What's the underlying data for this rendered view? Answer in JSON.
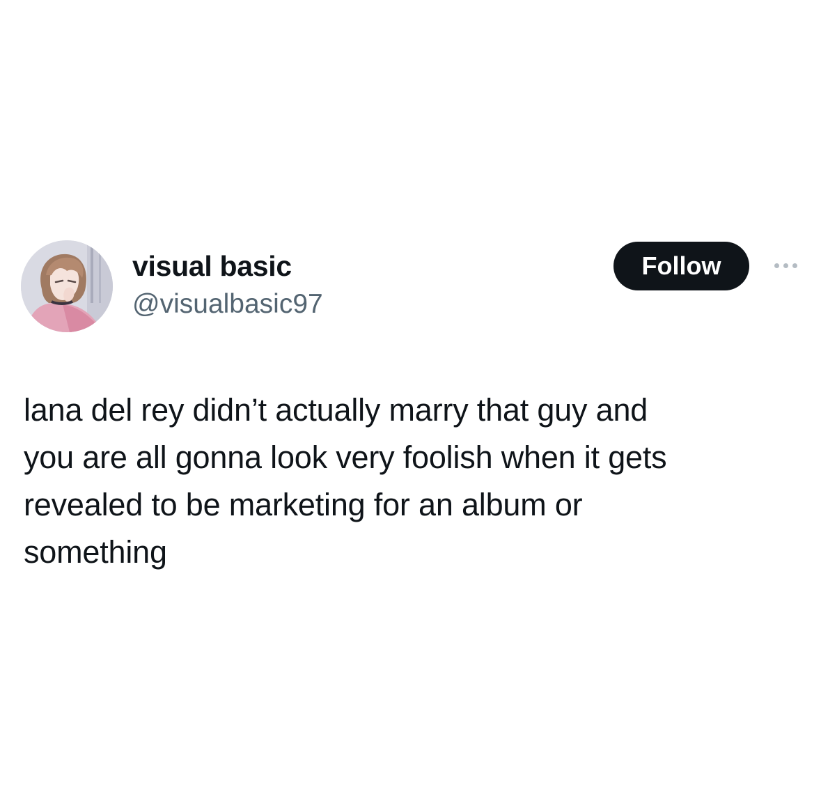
{
  "author": {
    "display_name": "visual basic",
    "handle": "@visualbasic97",
    "avatar_icon": "anime-avatar-image"
  },
  "actions": {
    "follow_label": "Follow",
    "more_icon": "more-dots-icon"
  },
  "tweet": {
    "lines": [
      "lana del rey didn’t actually marry that guy and",
      "you are all gonna look very foolish when it gets",
      "revealed to be marketing for an album or",
      "something"
    ]
  },
  "colors": {
    "background": "#ffffff",
    "text": "#0f1419",
    "handle": "#536471",
    "follow_bg": "#0f1419",
    "follow_text": "#ffffff",
    "more_dots": "#b4bcc3"
  }
}
